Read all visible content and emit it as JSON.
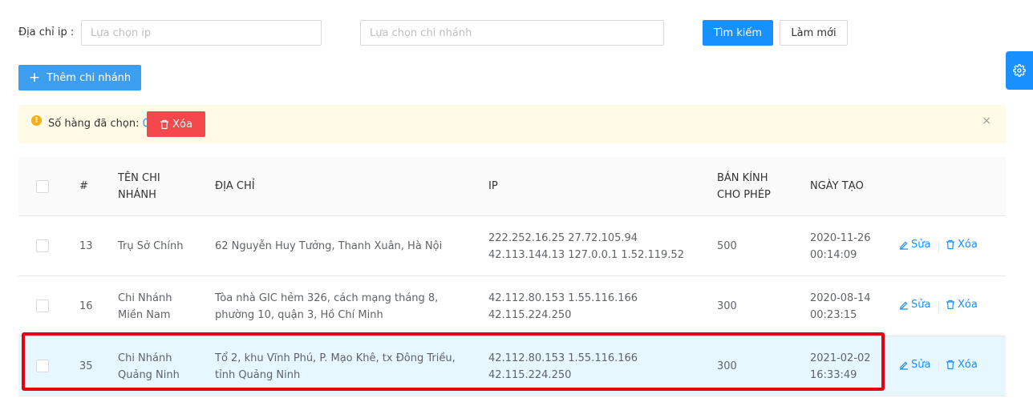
{
  "filters": {
    "ip_label": "Địa chỉ ip :",
    "ip_placeholder": "Lựa chọn ip",
    "branch_placeholder": "Lựa chọn chi nhánh",
    "search_label": "Tìm kiếm",
    "reset_label": "Làm mới"
  },
  "toolbar": {
    "add_label": "Thêm chi nhánh"
  },
  "alert": {
    "text": "Số hàng đã chọn:",
    "count": "0",
    "delete_label": "Xóa",
    "close": "×"
  },
  "table": {
    "headers": {
      "index": "#",
      "name": "TÊN CHI NHÁNH",
      "address": "ĐỊA CHỈ",
      "ip": "IP",
      "radius": "BÁN KÍNH CHO PHÉP",
      "created": "NGÀY TẠO"
    },
    "edit_label": "Sửa",
    "delete_label": "Xóa",
    "rows": [
      {
        "id": "13",
        "name": "Trụ Sở Chính",
        "address": "62 Nguyễn Huy Tưởng, Thanh Xuân, Hà Nội",
        "ip_line1": "222.252.16.25 27.72.105.94",
        "ip_line2": "42.113.144.13 127.0.0.1 1.52.119.52",
        "radius": "500",
        "date": "2020-11-26",
        "time": "00:14:09"
      },
      {
        "id": "16",
        "name_line1": "Chi Nhánh",
        "name_line2": "Miền Nam",
        "address_line1": "Tòa nhà GIC hẻm 326, cách mạng tháng 8,",
        "address_line2": "phường 10, quận 3, Hồ Chí Minh",
        "ip_line1": "42.112.80.153 1.55.116.166",
        "ip_line2": "42.115.224.250",
        "radius": "300",
        "date": "2020-08-14",
        "time": "00:23:15"
      },
      {
        "id": "35",
        "name_line1": "Chi Nhánh",
        "name_line2": "Quảng Ninh",
        "address_line1": "Tổ 2, khu Vĩnh Phú, P. Mạo Khê, tx Đông Triều,",
        "address_line2": "tỉnh Quảng Ninh",
        "ip_line1": "42.112.80.153 1.55.116.166",
        "ip_line2": "42.115.224.250",
        "radius": "300",
        "date": "2021-02-02",
        "time": "16:33:49"
      }
    ]
  },
  "colors": {
    "primary": "#1890ff",
    "danger": "#f5484d",
    "highlight_row": "#e6f7ff",
    "alert_bg": "#fffbe6",
    "annotation_box": "#e60012"
  }
}
